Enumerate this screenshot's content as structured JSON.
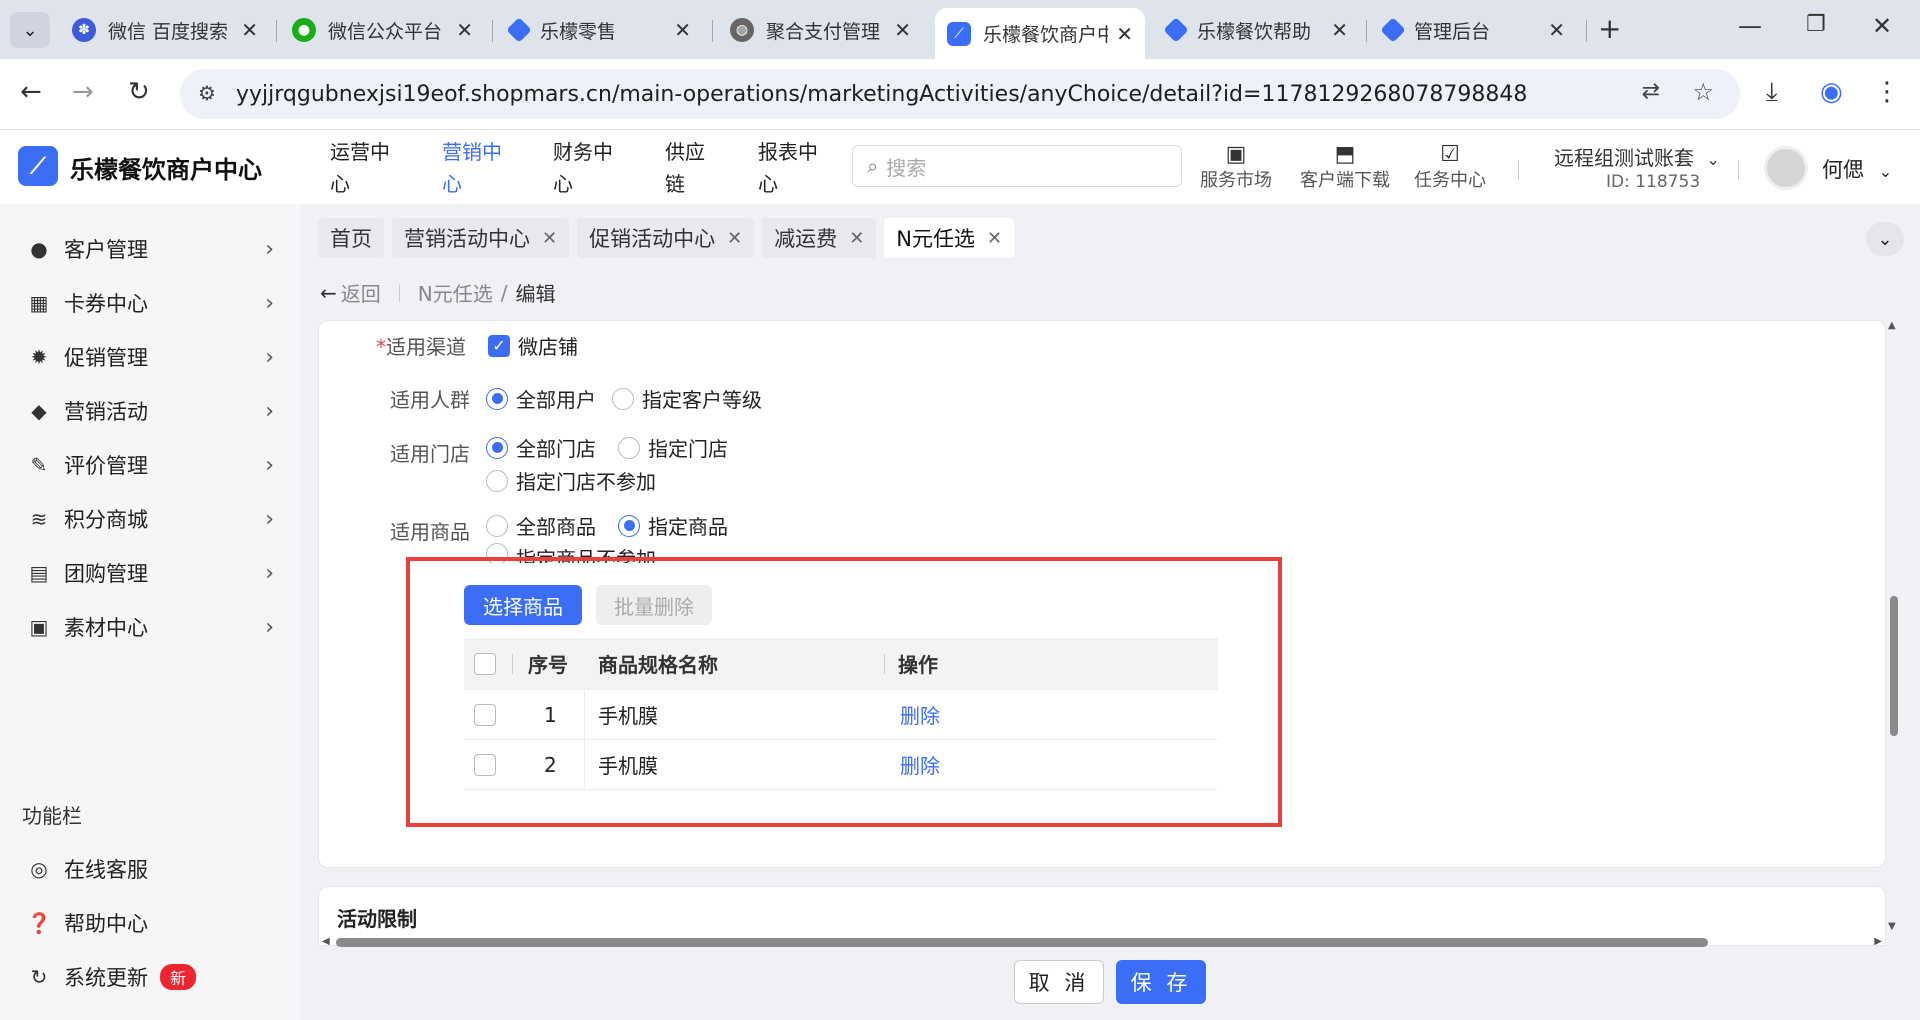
{
  "browser": {
    "tabs": [
      {
        "label": "微信 百度搜索",
        "icon": "baidu-icon",
        "color": "#3b5bdb"
      },
      {
        "label": "微信公众平台",
        "icon": "wechat-icon",
        "color": "#1aad19"
      },
      {
        "label": "乐檬零售",
        "icon": "diamond-icon",
        "color": "#3b6ef5"
      },
      {
        "label": "聚合支付管理",
        "icon": "globe-icon",
        "color": "#555555"
      },
      {
        "label": "乐檬餐饮商户中心",
        "icon": "lemeng-icon",
        "color": "#3b6ef5",
        "active": true
      },
      {
        "label": "乐檬餐饮帮助",
        "icon": "diamond-icon",
        "color": "#3b6ef5"
      },
      {
        "label": "管理后台",
        "icon": "diamond-icon",
        "color": "#3b6ef5"
      }
    ],
    "url": "yyjjrqgubnexjsi19eof.shopmars.cn/main-operations/marketingActivities/anyChoice/detail?id=1178129268078798848"
  },
  "header": {
    "logo": "乐檬餐饮商户中心",
    "nav": [
      {
        "label": "运营中心",
        "active": false
      },
      {
        "label": "营销中心",
        "active": true
      },
      {
        "label": "财务中心",
        "active": false
      },
      {
        "label": "供应链",
        "active": false
      },
      {
        "label": "报表中心",
        "active": false
      }
    ],
    "search_placeholder": "搜索",
    "icons": [
      {
        "label": "服务市场",
        "icon": "briefcase-icon"
      },
      {
        "label": "客户端下载",
        "icon": "download-folder-icon"
      },
      {
        "label": "任务中心",
        "icon": "task-clipboard-icon"
      }
    ],
    "account_name": "远程组测试账套",
    "account_id": "ID: 118753",
    "user_name": "何偲"
  },
  "sidebar": {
    "items": [
      {
        "label": "客户管理",
        "icon": "person-icon"
      },
      {
        "label": "卡券中心",
        "icon": "coupon-icon"
      },
      {
        "label": "促销管理",
        "icon": "promotion-icon"
      },
      {
        "label": "营销活动",
        "icon": "tag-icon"
      },
      {
        "label": "评价管理",
        "icon": "review-icon"
      },
      {
        "label": "积分商城",
        "icon": "coins-icon"
      },
      {
        "label": "团购管理",
        "icon": "gift-icon"
      },
      {
        "label": "素材中心",
        "icon": "image-icon"
      }
    ],
    "section_title": "功能栏",
    "tools": [
      {
        "label": "在线客服",
        "icon": "headset-icon"
      },
      {
        "label": "帮助中心",
        "icon": "help-icon"
      },
      {
        "label": "系统更新",
        "icon": "refresh-icon",
        "badge": "新"
      }
    ]
  },
  "page_tabs": [
    {
      "label": "首页",
      "closable": false
    },
    {
      "label": "营销活动中心",
      "closable": true
    },
    {
      "label": "促销活动中心",
      "closable": true
    },
    {
      "label": "减运费",
      "closable": true
    },
    {
      "label": "N元任选",
      "closable": true,
      "active": true
    }
  ],
  "breadcrumb": {
    "back": "返回",
    "parent": "N元任选",
    "sep": "/",
    "current": "编辑"
  },
  "form": {
    "channel": {
      "label": "适用渠道",
      "required": "*",
      "option": "微店铺",
      "checked": true
    },
    "audience": {
      "label": "适用人群",
      "options": [
        "全部用户",
        "指定客户等级"
      ],
      "selected": 0
    },
    "store": {
      "label": "适用门店",
      "options": [
        "全部门店",
        "指定门店",
        "指定门店不参加"
      ],
      "selected": 0
    },
    "goods": {
      "label": "适用商品",
      "options": [
        "全部商品",
        "指定商品",
        "指定商品不参加"
      ],
      "selected": 1
    },
    "select_goods_button": "选择商品",
    "batch_delete_button": "批量删除",
    "table": {
      "headers": [
        "序号",
        "商品规格名称",
        "操作"
      ],
      "rows": [
        {
          "index": "1",
          "name": "手机膜",
          "action": "删除"
        },
        {
          "index": "2",
          "name": "手机膜",
          "action": "删除"
        }
      ]
    }
  },
  "section2_title": "活动限制",
  "footer": {
    "cancel": "取 消",
    "save": "保 存"
  }
}
